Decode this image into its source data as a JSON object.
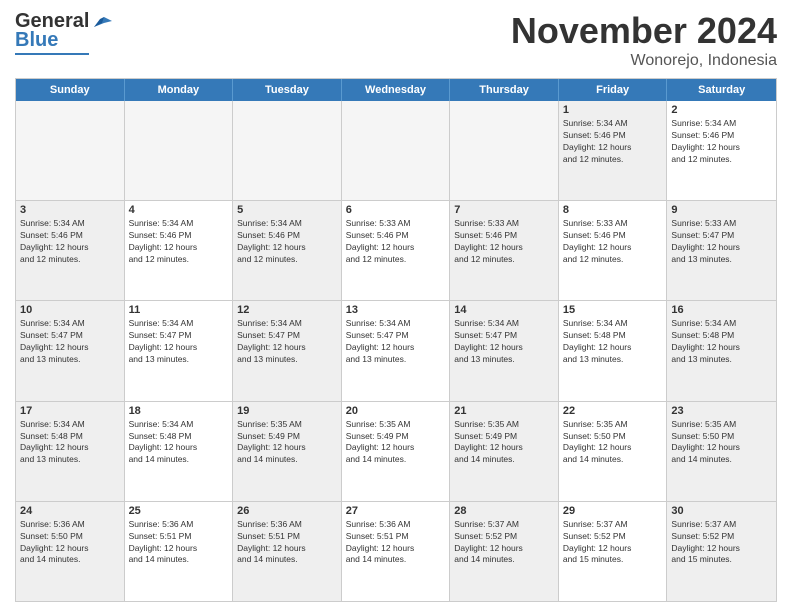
{
  "header": {
    "logo_line1": "General",
    "logo_line2": "Blue",
    "month_title": "November 2024",
    "location": "Wonorejo, Indonesia"
  },
  "calendar": {
    "weekdays": [
      "Sunday",
      "Monday",
      "Tuesday",
      "Wednesday",
      "Thursday",
      "Friday",
      "Saturday"
    ],
    "rows": [
      [
        {
          "day": "",
          "info": "",
          "empty": true
        },
        {
          "day": "",
          "info": "",
          "empty": true
        },
        {
          "day": "",
          "info": "",
          "empty": true
        },
        {
          "day": "",
          "info": "",
          "empty": true
        },
        {
          "day": "",
          "info": "",
          "empty": true
        },
        {
          "day": "1",
          "info": "Sunrise: 5:34 AM\nSunset: 5:46 PM\nDaylight: 12 hours\nand 12 minutes.",
          "shaded": true
        },
        {
          "day": "2",
          "info": "Sunrise: 5:34 AM\nSunset: 5:46 PM\nDaylight: 12 hours\nand 12 minutes.",
          "shaded": false
        }
      ],
      [
        {
          "day": "3",
          "info": "Sunrise: 5:34 AM\nSunset: 5:46 PM\nDaylight: 12 hours\nand 12 minutes.",
          "shaded": true
        },
        {
          "day": "4",
          "info": "Sunrise: 5:34 AM\nSunset: 5:46 PM\nDaylight: 12 hours\nand 12 minutes.",
          "shaded": false
        },
        {
          "day": "5",
          "info": "Sunrise: 5:34 AM\nSunset: 5:46 PM\nDaylight: 12 hours\nand 12 minutes.",
          "shaded": true
        },
        {
          "day": "6",
          "info": "Sunrise: 5:33 AM\nSunset: 5:46 PM\nDaylight: 12 hours\nand 12 minutes.",
          "shaded": false
        },
        {
          "day": "7",
          "info": "Sunrise: 5:33 AM\nSunset: 5:46 PM\nDaylight: 12 hours\nand 12 minutes.",
          "shaded": true
        },
        {
          "day": "8",
          "info": "Sunrise: 5:33 AM\nSunset: 5:46 PM\nDaylight: 12 hours\nand 12 minutes.",
          "shaded": false
        },
        {
          "day": "9",
          "info": "Sunrise: 5:33 AM\nSunset: 5:47 PM\nDaylight: 12 hours\nand 13 minutes.",
          "shaded": true
        }
      ],
      [
        {
          "day": "10",
          "info": "Sunrise: 5:34 AM\nSunset: 5:47 PM\nDaylight: 12 hours\nand 13 minutes.",
          "shaded": true
        },
        {
          "day": "11",
          "info": "Sunrise: 5:34 AM\nSunset: 5:47 PM\nDaylight: 12 hours\nand 13 minutes.",
          "shaded": false
        },
        {
          "day": "12",
          "info": "Sunrise: 5:34 AM\nSunset: 5:47 PM\nDaylight: 12 hours\nand 13 minutes.",
          "shaded": true
        },
        {
          "day": "13",
          "info": "Sunrise: 5:34 AM\nSunset: 5:47 PM\nDaylight: 12 hours\nand 13 minutes.",
          "shaded": false
        },
        {
          "day": "14",
          "info": "Sunrise: 5:34 AM\nSunset: 5:47 PM\nDaylight: 12 hours\nand 13 minutes.",
          "shaded": true
        },
        {
          "day": "15",
          "info": "Sunrise: 5:34 AM\nSunset: 5:48 PM\nDaylight: 12 hours\nand 13 minutes.",
          "shaded": false
        },
        {
          "day": "16",
          "info": "Sunrise: 5:34 AM\nSunset: 5:48 PM\nDaylight: 12 hours\nand 13 minutes.",
          "shaded": true
        }
      ],
      [
        {
          "day": "17",
          "info": "Sunrise: 5:34 AM\nSunset: 5:48 PM\nDaylight: 12 hours\nand 13 minutes.",
          "shaded": true
        },
        {
          "day": "18",
          "info": "Sunrise: 5:34 AM\nSunset: 5:48 PM\nDaylight: 12 hours\nand 14 minutes.",
          "shaded": false
        },
        {
          "day": "19",
          "info": "Sunrise: 5:35 AM\nSunset: 5:49 PM\nDaylight: 12 hours\nand 14 minutes.",
          "shaded": true
        },
        {
          "day": "20",
          "info": "Sunrise: 5:35 AM\nSunset: 5:49 PM\nDaylight: 12 hours\nand 14 minutes.",
          "shaded": false
        },
        {
          "day": "21",
          "info": "Sunrise: 5:35 AM\nSunset: 5:49 PM\nDaylight: 12 hours\nand 14 minutes.",
          "shaded": true
        },
        {
          "day": "22",
          "info": "Sunrise: 5:35 AM\nSunset: 5:50 PM\nDaylight: 12 hours\nand 14 minutes.",
          "shaded": false
        },
        {
          "day": "23",
          "info": "Sunrise: 5:35 AM\nSunset: 5:50 PM\nDaylight: 12 hours\nand 14 minutes.",
          "shaded": true
        }
      ],
      [
        {
          "day": "24",
          "info": "Sunrise: 5:36 AM\nSunset: 5:50 PM\nDaylight: 12 hours\nand 14 minutes.",
          "shaded": true
        },
        {
          "day": "25",
          "info": "Sunrise: 5:36 AM\nSunset: 5:51 PM\nDaylight: 12 hours\nand 14 minutes.",
          "shaded": false
        },
        {
          "day": "26",
          "info": "Sunrise: 5:36 AM\nSunset: 5:51 PM\nDaylight: 12 hours\nand 14 minutes.",
          "shaded": true
        },
        {
          "day": "27",
          "info": "Sunrise: 5:36 AM\nSunset: 5:51 PM\nDaylight: 12 hours\nand 14 minutes.",
          "shaded": false
        },
        {
          "day": "28",
          "info": "Sunrise: 5:37 AM\nSunset: 5:52 PM\nDaylight: 12 hours\nand 14 minutes.",
          "shaded": true
        },
        {
          "day": "29",
          "info": "Sunrise: 5:37 AM\nSunset: 5:52 PM\nDaylight: 12 hours\nand 15 minutes.",
          "shaded": false
        },
        {
          "day": "30",
          "info": "Sunrise: 5:37 AM\nSunset: 5:52 PM\nDaylight: 12 hours\nand 15 minutes.",
          "shaded": true
        }
      ]
    ]
  }
}
